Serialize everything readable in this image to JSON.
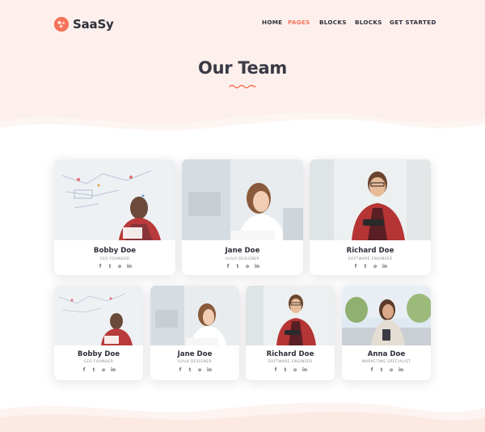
{
  "brand": {
    "name": "SaaSy",
    "accent": "#f6735b"
  },
  "nav": {
    "items": [
      {
        "label": "HOME",
        "active": false
      },
      {
        "label": "PAGES",
        "active": true
      },
      {
        "label": "BLOCKS",
        "active": false
      },
      {
        "label": "BLOCKS",
        "active": false
      },
      {
        "label": "GET STARTED",
        "active": false
      }
    ]
  },
  "hero": {
    "title": "Our Team"
  },
  "team_large": [
    {
      "name": "Bobby Doe",
      "role": "CEO FOUNDER"
    },
    {
      "name": "Jane Doe",
      "role": "UI/UX DESIGNER"
    },
    {
      "name": "Richard Doe",
      "role": "SOFTWARE ENGINEER"
    }
  ],
  "team_small": [
    {
      "name": "Bobby Doe",
      "role": "CEO FOUNDER"
    },
    {
      "name": "Jane Doe",
      "role": "UI/UX DESIGNER"
    },
    {
      "name": "Richard Doe",
      "role": "SOFTWARE ENGINEER"
    },
    {
      "name": "Anna Doe",
      "role": "MARKETING SPECIALIST"
    }
  ],
  "social_icons": [
    "facebook-icon",
    "twitter-icon",
    "instagram-icon",
    "linkedin-icon"
  ],
  "social_glyphs": {
    "facebook": "f",
    "twitter": "t",
    "instagram": "o",
    "linkedin": "in"
  }
}
